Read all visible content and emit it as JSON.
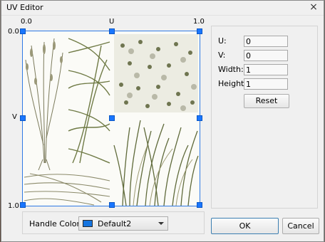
{
  "window": {
    "title": "UV Editor",
    "close_glyph": "×"
  },
  "axes": {
    "u_start": "0.0",
    "u_label": "U",
    "u_end": "1.0",
    "v_start": "0.0",
    "v_label": "V",
    "v_end": "1.0"
  },
  "uv_colors": {
    "selection_border": "#2f7be5",
    "handle": "#1976ff"
  },
  "handle_color": {
    "label": "Handle Color:",
    "selected": "Default2",
    "swatch": "#1474e0"
  },
  "properties": {
    "u": {
      "label": "U:",
      "value": "0"
    },
    "v": {
      "label": "V:",
      "value": "0"
    },
    "width": {
      "label": "Width:",
      "value": "1"
    },
    "height": {
      "label": "Height:",
      "value": "1"
    },
    "reset_label": "Reset"
  },
  "buttons": {
    "ok": "OK",
    "cancel": "Cancel"
  }
}
